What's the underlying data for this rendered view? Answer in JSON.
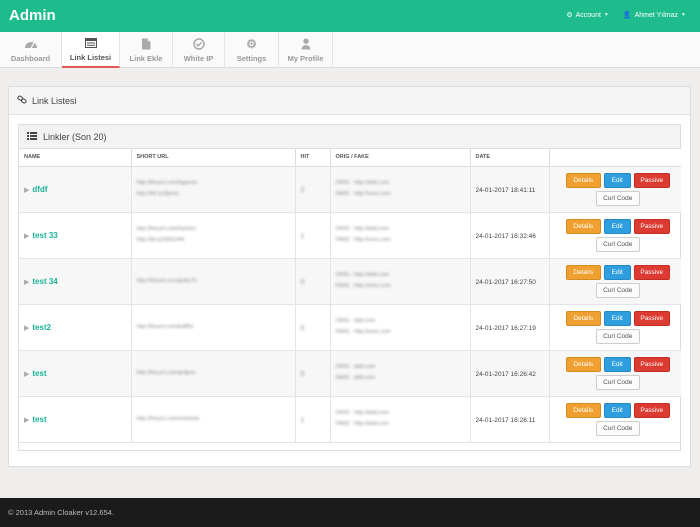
{
  "app": {
    "title": "Admin"
  },
  "topnav": {
    "account_label": "Account",
    "user_label": "Ahmet Yılmaz"
  },
  "tabs": [
    {
      "label": "Dashboard",
      "icon": "dashboard-icon"
    },
    {
      "label": "Link Listesi",
      "icon": "list-icon",
      "active": true
    },
    {
      "label": "Link Ekle",
      "icon": "file-icon"
    },
    {
      "label": "White IP",
      "icon": "check-circle-icon"
    },
    {
      "label": "Settings",
      "icon": "gear-icon"
    },
    {
      "label": "My Profile",
      "icon": "user-icon"
    }
  ],
  "panel": {
    "title": "Link Listesi"
  },
  "table_panel": {
    "title": "Linkler (Son 20)"
  },
  "columns": [
    "NAME",
    "SHORT URL",
    "HIT",
    "ORIG / FAKE",
    "DATE",
    ""
  ],
  "rows": [
    {
      "name": "dfdf",
      "short1": "http://tinyurl.com/hgjznsn",
      "short2": "http://bit.ly/2jkzrlo",
      "hit": "2",
      "orig": "ORIG : http://ddd.com",
      "fake": "FAKE : http://xxxx.com",
      "date": "24-01-2017 18:41:11"
    },
    {
      "name": "test 33",
      "short1": "http://tinyurl.com/hyk4zn",
      "short2": "http://bit.ly/2jN2rHN",
      "hit": "1",
      "orig": "ORIG : http://ddd.com",
      "fake": "FAKE : http://xxxx.com",
      "date": "24-01-2017 16:32:46"
    },
    {
      "name": "test 34",
      "short1": "http://tinyurl.com/jpxky7k",
      "short2": "",
      "hit": "0",
      "orig": "ORIG : http://ddd.com",
      "fake": "FAKE : http://xxxx.com",
      "date": "24-01-2017 16:27:50"
    },
    {
      "name": "test2",
      "short1": "http://tinyurl.com/jrqff5e",
      "short2": "",
      "hit": "0",
      "orig": "ORIG : ddd.com",
      "fake": "FAKE : http://xxxx.com",
      "date": "24-01-2017 16:27:19"
    },
    {
      "name": "test",
      "short1": "http://tinyurl.com/gnfjyxe",
      "short2": "",
      "hit": "0",
      "orig": "ORIG : ddd.com",
      "fake": "FAKE : ddd.com",
      "date": "24-01-2017 16:26:42"
    },
    {
      "name": "test",
      "short1": "http://tinyurl.com/zeeeeee",
      "short2": "",
      "hit": "1",
      "orig": "ORIG : http://ddd.com",
      "fake": "FAKE : http://ddd.com",
      "date": "24-01-2017 16:26:11"
    }
  ],
  "buttons": {
    "details": "Details",
    "edit": "Edit",
    "passive": "Passive",
    "curl": "Curl Code"
  },
  "footer": {
    "text": "© 2013 Admin Cloaker v12.654."
  },
  "colors": {
    "brand": "#1ebc8c",
    "details": "#f0a030",
    "edit": "#2e9ede",
    "passive": "#dd3b32",
    "link": "#1ab39a"
  }
}
